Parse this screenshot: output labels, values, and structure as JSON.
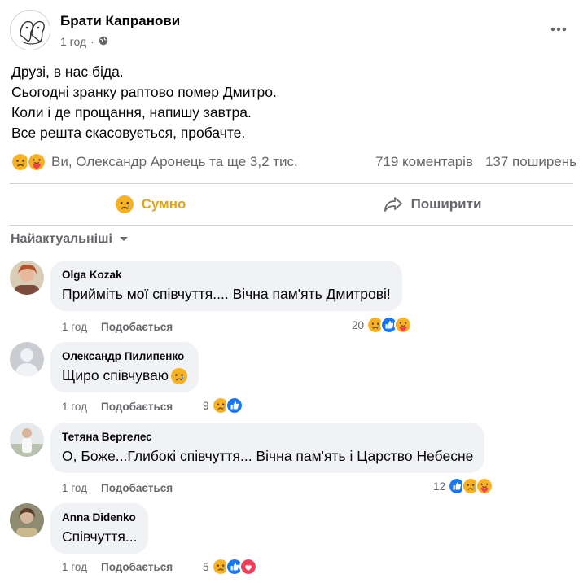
{
  "post": {
    "author": "Брати Капранови",
    "time": "1 год",
    "separator": "·",
    "privacy_icon": "globe-icon",
    "lines": [
      "Друзі, в нас біда.",
      "Сьогодні зранку раптово помер Дмитро.",
      "Коли і де прощання, напишу завтра.",
      "Все решта скасовується, пробачте."
    ],
    "reactions_text": "Ви, Олександр Аронець та ще 3,2 тис.",
    "comments_count": "719 коментарів",
    "shares_count": "137 поширень"
  },
  "actions": {
    "sad_label": "Сумно",
    "share_label": "Поширити"
  },
  "sort_label": "Найактуальніші",
  "comments": [
    {
      "author": "Olga Kozak",
      "text": "Прийміть мої співчуття.... Вічна пам'ять Дмитрові!",
      "time": "1 год",
      "like": "Подобається",
      "count": "20",
      "reactions": [
        "sad",
        "like",
        "care"
      ]
    },
    {
      "author": "Олександр Пилипенко",
      "text": "Щиро співчуваю",
      "time": "1 год",
      "like": "Подобається",
      "count": "9",
      "reactions": [
        "sad",
        "like"
      ]
    },
    {
      "author": "Тетяна Вергелес",
      "text": "О, Боже...Глибокі співчуття... Вічна пам'ять і Царство Небесне",
      "time": "1 год",
      "like": "Подобається",
      "count": "12",
      "reactions": [
        "like",
        "sad",
        "care"
      ]
    },
    {
      "author": "Anna Didenko",
      "text": "Співчуття...",
      "time": "1 год",
      "like": "Подобається",
      "count": "5",
      "reactions": [
        "sad",
        "like",
        "love"
      ]
    }
  ],
  "colors": {
    "sad_reaction": "#f7b125",
    "like_reaction": "#1877f2",
    "love_reaction": "#f33e58",
    "secondary_text": "#65676b",
    "bubble_bg": "#f0f2f5"
  }
}
